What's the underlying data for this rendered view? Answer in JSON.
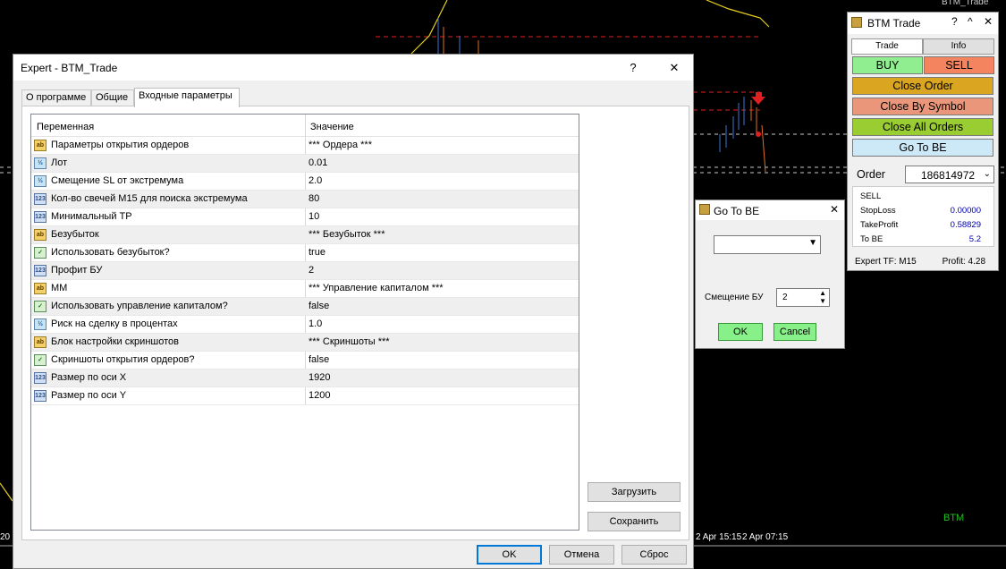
{
  "expert_dialog": {
    "title": "Expert - BTM_Trade",
    "help_glyph": "?",
    "close_glyph": "✕",
    "tabs": [
      "О программе",
      "Общие",
      "Входные параметры"
    ],
    "active_tab": 2,
    "columns": [
      "Переменная",
      "Значение"
    ],
    "rows": [
      {
        "icon": "ab",
        "name": "Параметры открытия ордеров",
        "value": "*** Ордера ***"
      },
      {
        "icon": "v2",
        "name": "Лот",
        "value": "0.01"
      },
      {
        "icon": "v2",
        "name": "Смещение SL от экстремума",
        "value": "2.0"
      },
      {
        "icon": "123",
        "name": "Кол-во свечей M15 для поиска экстремума",
        "value": "80"
      },
      {
        "icon": "123",
        "name": "Минимальный TP",
        "value": "10"
      },
      {
        "icon": "ab",
        "name": "Безубыток",
        "value": "*** Безубыток ***"
      },
      {
        "icon": "bool",
        "name": "Использовать безубыток?",
        "value": "true"
      },
      {
        "icon": "123",
        "name": "Профит БУ",
        "value": "2"
      },
      {
        "icon": "ab",
        "name": "ММ",
        "value": "*** Управление капиталом ***"
      },
      {
        "icon": "bool",
        "name": "Использовать управление капиталом?",
        "value": "false"
      },
      {
        "icon": "v2",
        "name": "Риск на сделку в процентах",
        "value": "1.0"
      },
      {
        "icon": "ab",
        "name": "Блок настройки скриншотов",
        "value": "*** Скриншоты ***"
      },
      {
        "icon": "bool",
        "name": "Скриншоты открытия ордеров?",
        "value": "false"
      },
      {
        "icon": "123",
        "name": "Размер по оси X",
        "value": "1920"
      },
      {
        "icon": "123",
        "name": "Размер по оси Y",
        "value": "1200"
      }
    ],
    "load_label": "Загрузить",
    "save_label": "Сохранить",
    "ok_label": "OK",
    "cancel_label": "Отмена",
    "reset_label": "Сброс"
  },
  "gotobe_dialog": {
    "title": "Go To BE",
    "close_glyph": "✕",
    "combo_value": "",
    "offset_label": "Смещение БУ",
    "offset_value": "2",
    "ok_label": "OK",
    "cancel_label": "Cancel"
  },
  "btm_panel": {
    "title": "BTM Trade",
    "tabs": [
      "Trade",
      "Info"
    ],
    "buy_label": "BUY",
    "sell_label": "SELL",
    "close_order_label": "Close Order",
    "close_by_symbol_label": "Close By Symbol",
    "close_all_label": "Close All Orders",
    "goto_be_label": "Go To BE",
    "order_label": "Order",
    "order_value": "186814972",
    "info": {
      "side": "SELL",
      "stoploss_label": "StopLoss",
      "stoploss_value": "0.00000",
      "takeprofit_label": "TakeProfit",
      "takeprofit_value": "0.58829",
      "tobe_label": "To BE",
      "tobe_value": "5.2"
    },
    "expert_tf": "Expert TF:  M15",
    "profit": "Profit: 4.28",
    "colors": {
      "buy": "#90ee90",
      "sell": "#f4845f",
      "close_order": "#daa520",
      "close_by_symbol": "#e9967a",
      "close_all": "#9acd32",
      "goto_be": "#cde8f7"
    }
  },
  "chart": {
    "top_label": "BTM_Trade",
    "time_labels": [
      "2 Apr 15:15",
      "2 Apr 07:15"
    ],
    "left_time": "20",
    "watermark": "BTM"
  }
}
